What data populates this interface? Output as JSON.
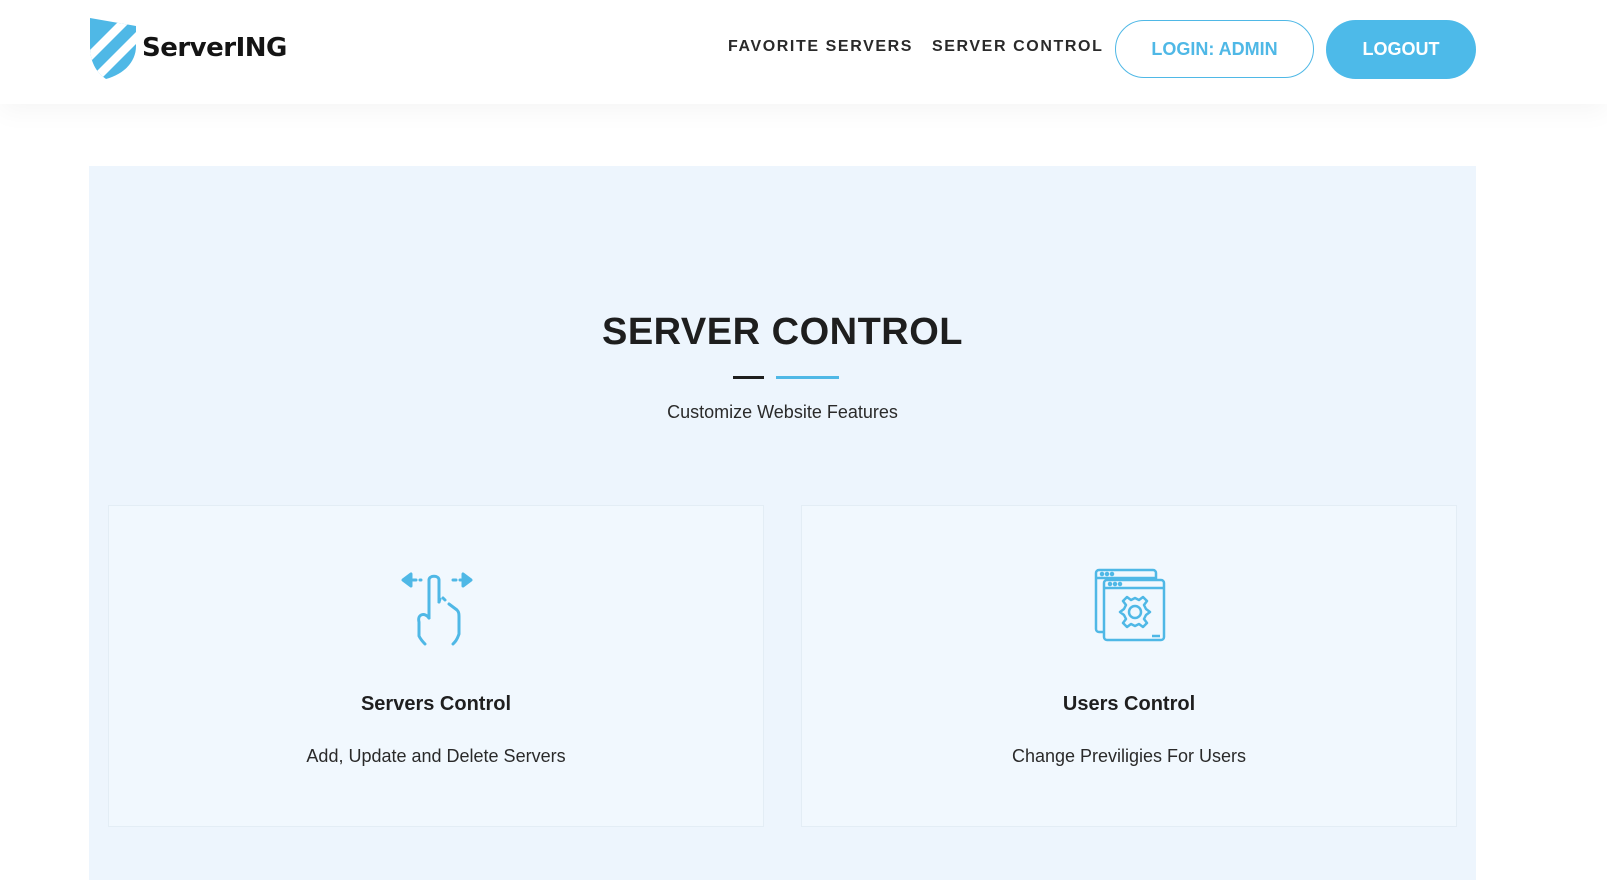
{
  "brand": {
    "name": "ServerING",
    "color": "#4fb8e6"
  },
  "nav": {
    "favorite_servers": "FAVORITE SERVERS",
    "server_control": "SERVER CONTROL",
    "login_label": "LOGIN: ADMIN",
    "logout_label": "LOGOUT"
  },
  "section": {
    "title": "SERVER CONTROL",
    "subtitle": "Customize Website Features",
    "background": "#edf5fd"
  },
  "cards": [
    {
      "icon": "swipe-gesture-icon",
      "title": "Servers Control",
      "description": "Add, Update and Delete Servers"
    },
    {
      "icon": "browser-settings-icon",
      "title": "Users Control",
      "description": "Change Previligies For Users"
    }
  ]
}
